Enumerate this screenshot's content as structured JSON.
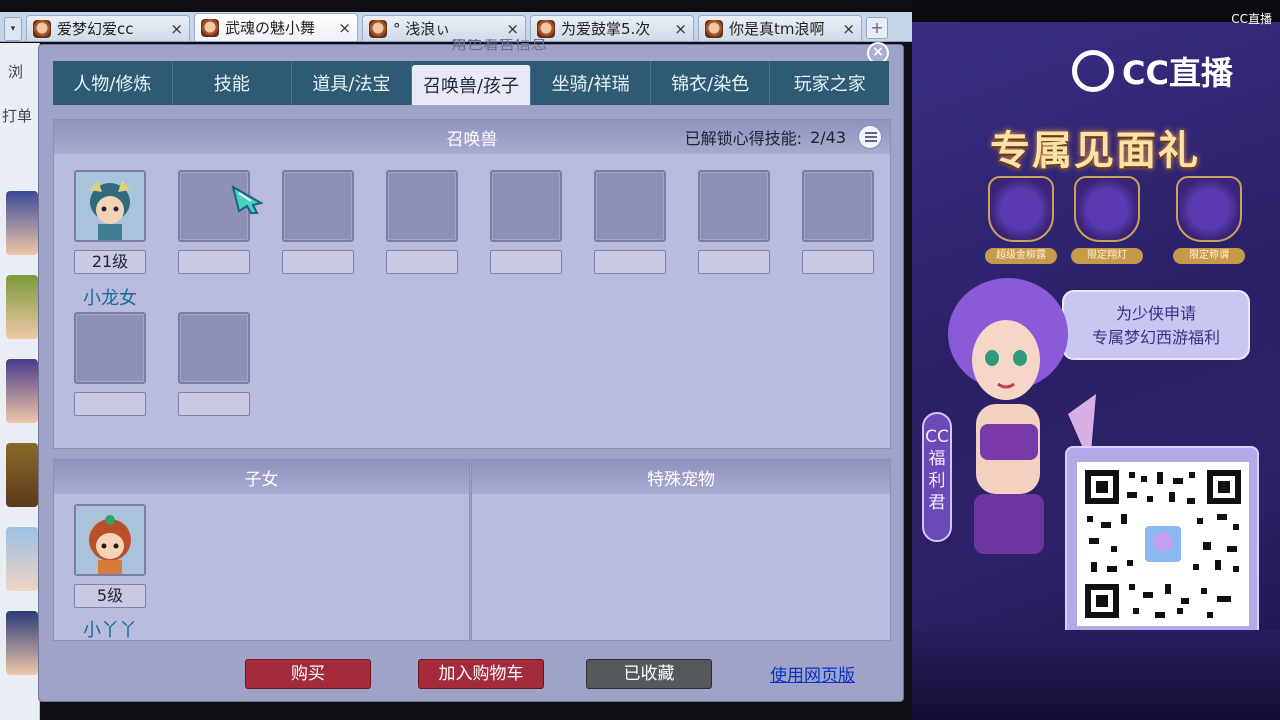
{
  "browser": {
    "tabs": [
      {
        "title": "爱梦幻爱cc",
        "active": false
      },
      {
        "title": "武魂の魅小舞",
        "active": true
      },
      {
        "title": "° 浅浪ぃ",
        "active": false
      },
      {
        "title": "为爱鼓掌5.次",
        "active": false
      },
      {
        "title": "你是真tm浪啊",
        "active": false
      }
    ],
    "close_glyph": "×",
    "add_glyph": "+",
    "menu_glyph": "▾"
  },
  "left_strip": {
    "line1": "浏",
    "line2": "打单"
  },
  "panel": {
    "title_partial": "角色着售信息",
    "close_glyph": "×",
    "nav_tabs": [
      "人物/修炼",
      "技能",
      "道具/法宝",
      "召唤兽/孩子",
      "坐骑/祥瑞",
      "锦衣/染色",
      "玩家之家"
    ],
    "active_tab": 3,
    "summon": {
      "header": "召唤兽",
      "skill_label": "已解锁心得技能:",
      "skill_value": "2/43",
      "pets": [
        {
          "level": "21级",
          "name": "小龙女",
          "filled": true
        },
        {
          "level": "",
          "name": "",
          "filled": false
        },
        {
          "level": "",
          "name": "",
          "filled": false
        },
        {
          "level": "",
          "name": "",
          "filled": false
        },
        {
          "level": "",
          "name": "",
          "filled": false
        },
        {
          "level": "",
          "name": "",
          "filled": false
        },
        {
          "level": "",
          "name": "",
          "filled": false
        },
        {
          "level": "",
          "name": "",
          "filled": false
        },
        {
          "level": "",
          "name": "",
          "filled": false
        },
        {
          "level": "",
          "name": "",
          "filled": false
        }
      ]
    },
    "children": {
      "header": "子女",
      "items": [
        {
          "level": "5级",
          "name": "小丫丫"
        }
      ]
    },
    "special_pets": {
      "header": "特殊宠物"
    },
    "buttons": {
      "buy": "购买",
      "cart": "加入购物车",
      "favorited": "已收藏",
      "web": "使用网页版"
    }
  },
  "promo": {
    "brand_small": "CC直播",
    "brand": "CC直播",
    "title": "专属见面礼",
    "gifts": [
      "超级金柳露",
      "限定翔灯",
      "限定称谓"
    ],
    "bubble_line1": "为少侠申请",
    "bubble_line2": "专属梦幻西游福利",
    "tag": "CC福利君"
  },
  "colors": {
    "nav_bg": "#2f5a73",
    "panel_bg": "#9fa3c7",
    "buy_red": "#a42a3c",
    "favorited_gray": "#55595c",
    "link_blue": "#0a31c6",
    "pet_name": "#1a6b93",
    "promo_purple": "#2b2066",
    "promo_title_gold": "#fbe3a8"
  }
}
